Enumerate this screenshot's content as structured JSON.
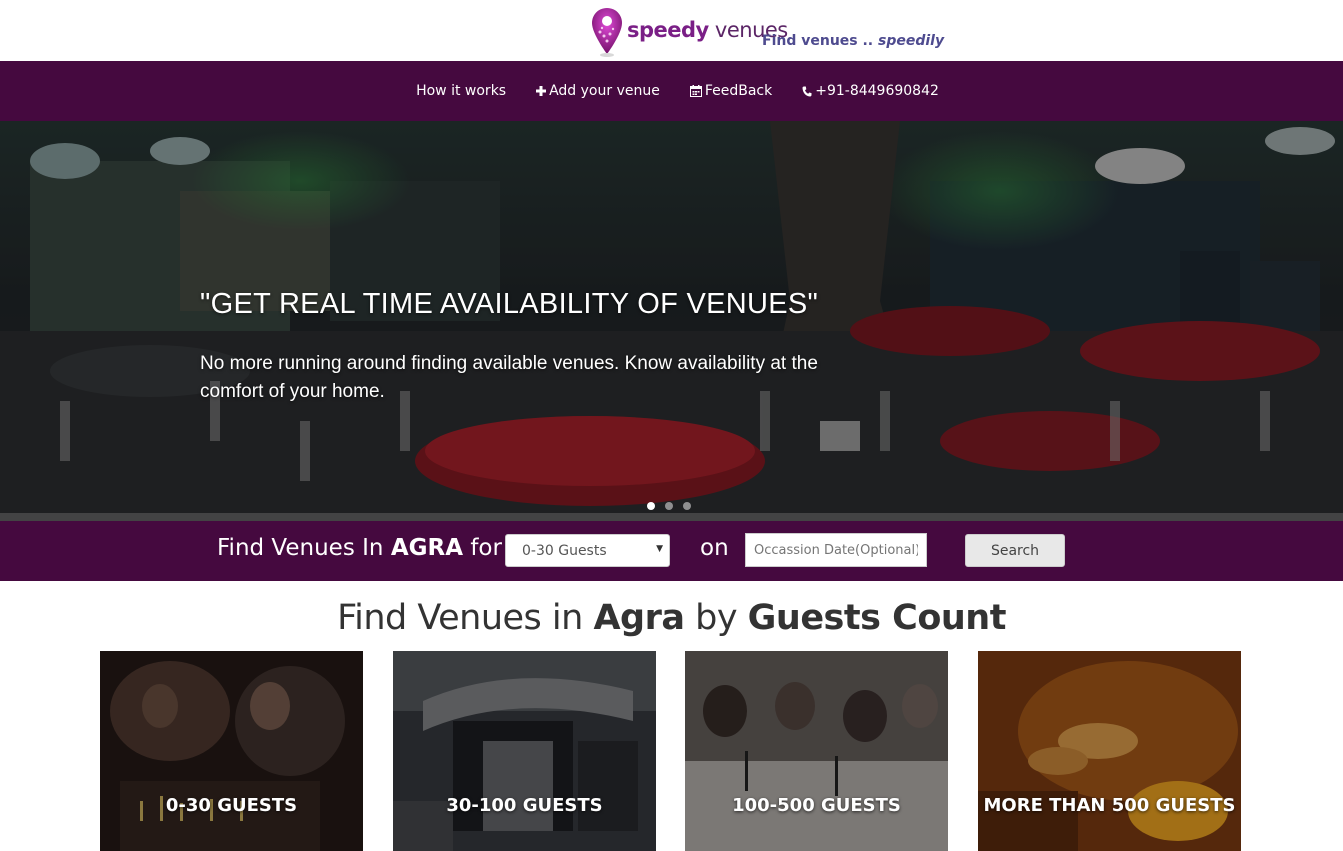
{
  "header": {
    "logo_text_bold": "speedy",
    "logo_text_light": " venues",
    "tagline_prefix": "Find venues .. ",
    "tagline_emph": "speedily"
  },
  "nav": {
    "items": [
      {
        "label": "How it works",
        "icon": "none"
      },
      {
        "label": "Add your venue",
        "icon": "plus-icon"
      },
      {
        "label": "FeedBack",
        "icon": "calendar-icon"
      },
      {
        "label": "+91-8449690842",
        "icon": "phone-icon"
      }
    ]
  },
  "hero": {
    "title": "\"GET REAL TIME AVAILABILITY OF VENUES\"",
    "subtitle": "No more running around finding available venues. Know availability at the comfort of your home.",
    "slides": 3,
    "active_slide": 1
  },
  "search": {
    "label_prefix": "Find Venues In ",
    "city": "AGRA",
    "label_suffix": " for",
    "guests_selected": "0-30 Guests",
    "on_label": "on",
    "date_placeholder": "Occassion Date(Optional)",
    "button_label": "Search"
  },
  "section": {
    "title_prefix": "Find Venues in ",
    "city": "Agra",
    "title_mid": " by ",
    "title_bold": "Guests Count"
  },
  "cards": [
    {
      "label": "0-30 GUESTS"
    },
    {
      "label": "30-100 GUESTS"
    },
    {
      "label": "100-500 GUESTS"
    },
    {
      "label": "MORE THAN 500 GUESTS"
    }
  ],
  "colors": {
    "brand_purple": "#45093f",
    "logo_purple": "#7a1f86",
    "tagline_blue": "#4e4b8f"
  }
}
